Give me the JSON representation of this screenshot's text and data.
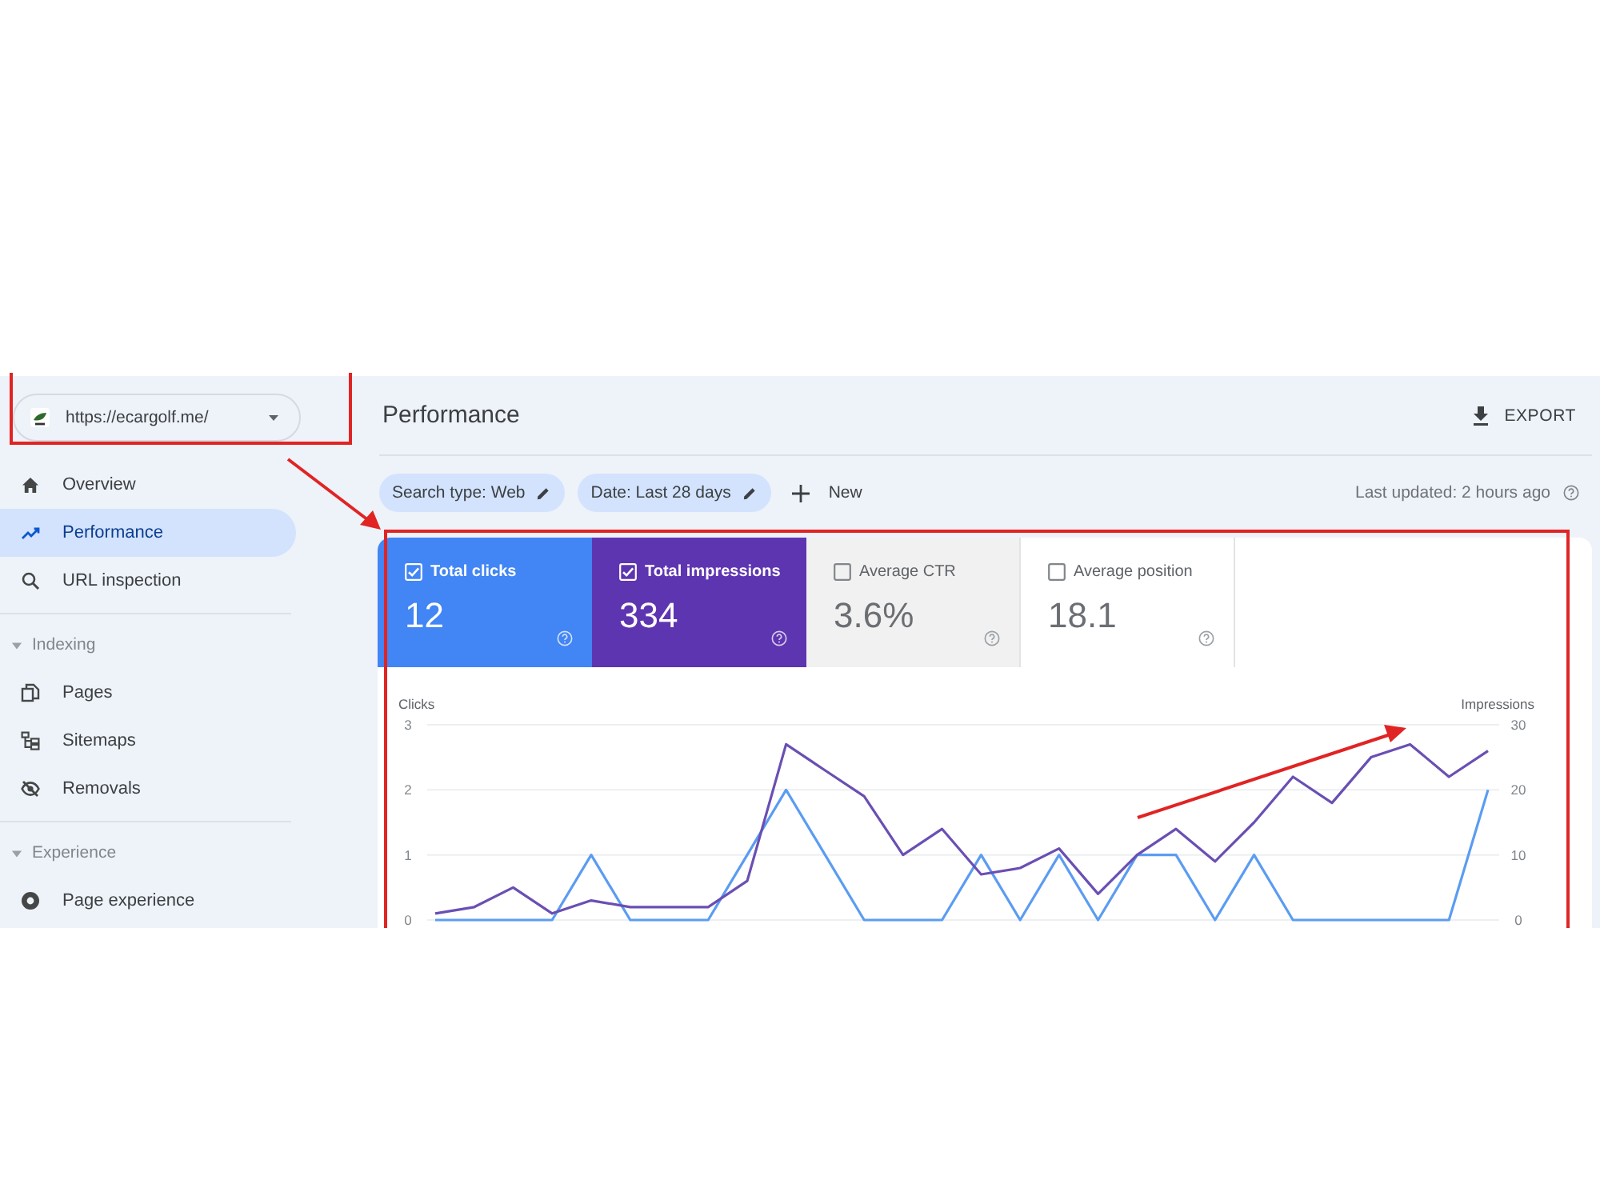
{
  "property_selector": {
    "url": "https://ecargolf.me/"
  },
  "nav": {
    "items": [
      {
        "label": "Overview",
        "selected": false
      },
      {
        "label": "Performance",
        "selected": true
      },
      {
        "label": "URL inspection",
        "selected": false
      }
    ],
    "sections": [
      {
        "title": "Indexing",
        "expanded": true,
        "items": [
          {
            "label": "Pages",
            "selected": false
          },
          {
            "label": "Sitemaps",
            "selected": false
          },
          {
            "label": "Removals",
            "selected": false
          }
        ]
      },
      {
        "title": "Experience",
        "expanded": true,
        "items": [
          {
            "label": "Page experience",
            "selected": false
          }
        ]
      }
    ]
  },
  "header": {
    "title": "Performance",
    "export_label": "EXPORT"
  },
  "filters": {
    "chips": [
      {
        "label": "Search type: Web"
      },
      {
        "label": "Date: Last 28 days"
      }
    ],
    "new_label": "New",
    "last_updated": "Last updated: 2 hours ago"
  },
  "metrics": [
    {
      "label": "Total clicks",
      "value": "12",
      "checked": true,
      "hovered": false,
      "color": "#4285f4"
    },
    {
      "label": "Total impressions",
      "value": "334",
      "checked": true,
      "hovered": false,
      "color": "#5e35b1"
    },
    {
      "label": "Average CTR",
      "value": "3.6%",
      "checked": false,
      "hovered": true
    },
    {
      "label": "Average position",
      "value": "18.1",
      "checked": false,
      "hovered": false
    }
  ],
  "chart_data": {
    "type": "line",
    "ylabel": "Clicks",
    "y2label": "Impressions",
    "ylim": [
      0,
      3
    ],
    "y2lim": [
      0,
      30
    ],
    "yticks": [
      0,
      1,
      2,
      3
    ],
    "y2ticks": [
      0,
      10,
      20,
      30
    ],
    "grid": true,
    "series": [
      {
        "color": "#5b9cf2",
        "values": [
          0,
          0,
          0,
          0,
          1,
          0,
          0,
          0,
          1,
          2,
          1,
          0,
          0,
          0,
          1,
          0,
          1,
          0,
          1,
          1,
          0,
          1,
          0,
          0,
          0,
          0,
          0,
          2
        ]
      },
      {
        "color": "#6a4fb3",
        "axis": "y2",
        "values": [
          1,
          2,
          5,
          1,
          3,
          2,
          2,
          2,
          6,
          27,
          23,
          19,
          10,
          14,
          7,
          8,
          11,
          4,
          10,
          14,
          9,
          15,
          22,
          18,
          25,
          27,
          22,
          26
        ]
      }
    ]
  }
}
